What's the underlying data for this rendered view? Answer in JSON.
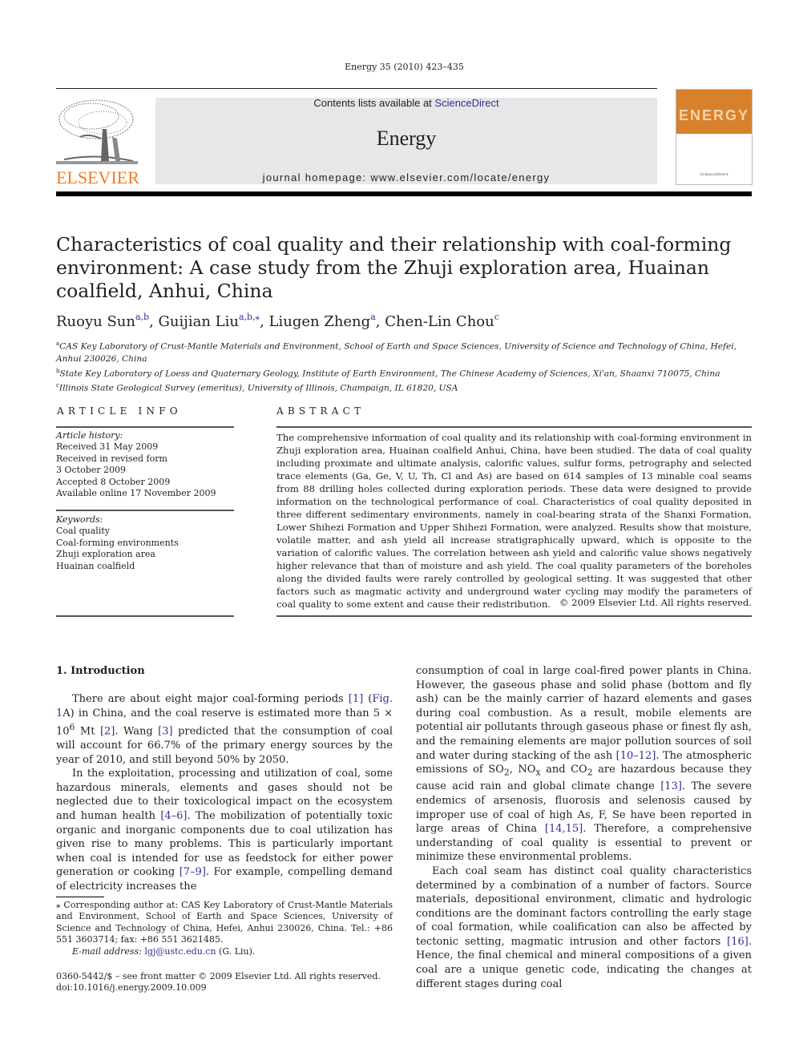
{
  "header": {
    "journal_ref": "Energy 35 (2010) 423–435",
    "contents_prefix": "Contents lists available at ",
    "contents_link": "ScienceDirect",
    "journal_name": "Energy",
    "homepage": "journal homepage: www.elsevier.com/locate/energy",
    "publisher_logo_text": "ELSEVIER",
    "cover_title": "ENERGY",
    "cover_footer": "ScienceDirect"
  },
  "colors": {
    "link": "#2e3192",
    "elsevier_orange": "#f27b21",
    "banner_gray": "#e6e7e8",
    "cover_orange": "#d8812d"
  },
  "article": {
    "title": "Characteristics of coal quality and their relationship with coal-forming environment: A case study from the Zhuji exploration area, Huainan coalfield, Anhui, China",
    "authors": [
      {
        "name": "Ruoyu Sun",
        "aff": "a,b"
      },
      {
        "name": "Guijian Liu",
        "aff": "a,b,⁎"
      },
      {
        "name": "Liugen Zheng",
        "aff": "a"
      },
      {
        "name": "Chen-Lin Chou",
        "aff": "c"
      }
    ],
    "affiliations": [
      {
        "mark": "a",
        "text": "CAS Key Laboratory of Crust-Mantle Materials and Environment, School of Earth and Space Sciences, University of Science and Technology of China, Hefei, Anhui 230026, China"
      },
      {
        "mark": "b",
        "text": "State Key Laboratory of Loess and Quaternary Geology, Institute of Earth Environment, The Chinese Academy of Sciences, Xi'an, Shaanxi 710075, China"
      },
      {
        "mark": "c",
        "text": "Illinois State Geological Survey (emeritus), University of Illinois, Champaign, IL 61820, USA"
      }
    ]
  },
  "article_info": {
    "heading": "ARTICLE INFO",
    "history_label": "Article history:",
    "history": [
      "Received 31 May 2009",
      "Received in revised form",
      "3 October 2009",
      "Accepted 8 October 2009",
      "Available online 17 November 2009"
    ],
    "keywords_label": "Keywords:",
    "keywords": [
      "Coal quality",
      "Coal-forming environments",
      "Zhuji exploration area",
      "Huainan coalfield"
    ]
  },
  "abstract": {
    "heading": "ABSTRACT",
    "text": "The comprehensive information of coal quality and its relationship with coal-forming environment in Zhuji exploration area, Huainan coalfield Anhui, China, have been studied. The data of coal quality including proximate and ultimate analysis, calorific values, sulfur forms, petrography and selected trace elements (Ga, Ge, V, U, Th, Cl and As) are based on 614 samples of 13 minable coal seams from 88 drilling holes collected during exploration periods. These data were designed to provide information on the technological performance of coal. Characteristics of coal quality deposited in three different sedimentary environments, namely in coal-bearing strata of the Shanxi Formation, Lower Shihezi Formation and Upper Shihezi Formation, were analyzed. Results show that moisture, volatile matter, and ash yield all increase stratigraphically upward, which is opposite to the variation of calorific values. The correlation between ash yield and calorific value shows negatively higher relevance that than of moisture and ash yield. The coal quality parameters of the boreholes along the divided faults were rarely controlled by geological setting. It was suggested that other factors such as magmatic activity and underground water cycling may modify the parameters of coal quality to some extent and cause their redistribution.",
    "copyright": "© 2009 Elsevier Ltd. All rights reserved."
  },
  "body": {
    "section_heading": "1.  Introduction",
    "col1": {
      "p1": [
        "There are about eight major coal-forming periods ",
        "[1]",
        " (",
        "Fig. 1",
        "A) in China, and the coal reserve is estimated more than 5 × 10",
        "6",
        " Mt ",
        "[2]",
        ". Wang ",
        "[3]",
        " predicted that the consumption of coal will account for 66.7% of the primary energy sources by the year of 2010, and still beyond 50% by 2050."
      ],
      "p2": [
        "In the exploitation, processing and utilization of coal, some hazardous minerals, elements and gases should not be neglected due to their toxicological impact on the ecosystem and human health ",
        "[4–6]",
        ". The mobilization of potentially toxic organic and inorganic components due to coal utilization has given rise to many problems. This is particularly important when coal is intended for use as feedstock for either power generation or cooking ",
        "[7–9]",
        ". For example, compelling demand of electricity increases the"
      ]
    },
    "col2": {
      "p1": [
        "consumption of coal in large coal-fired power plants in China. However, the gaseous phase and solid phase (bottom and fly ash) can be the mainly carrier of hazard elements and gases during coal combustion. As a result, mobile elements are potential air pollutants through gaseous phase or finest fly ash, and the remaining elements are major pollution sources of soil and water during stacking of the ash ",
        "[10–12]",
        ". The atmospheric emissions of SO",
        "2",
        ", NO",
        "x",
        " and CO",
        "2",
        " are hazardous because they cause acid rain and global climate change ",
        "[13]",
        ". The severe endemics of arsenosis, fluorosis and selenosis caused by improper use of coal of high As, F, Se have been reported in large areas of China ",
        "[14,15]",
        ". Therefore, a comprehensive understanding of coal quality is essential to prevent or minimize these environmental problems."
      ],
      "p2": [
        "Each coal seam has distinct coal quality characteristics determined by a combination of a number of factors. Source materials, depositional environment, climatic and hydrologic conditions are the dominant factors controlling the early stage of coal formation, while coalification can also be affected by tectonic setting, magmatic intrusion and other factors ",
        "[16]",
        ". Hence, the final chemical and mineral compositions of a given coal are a unique genetic code, indicating the changes at different stages during coal"
      ]
    }
  },
  "footnote": {
    "corresponding": "⁎  Corresponding author at: CAS Key Laboratory of Crust-Mantle Materials and Environment, School of Earth and Space Sciences, University of Science and Technology of China, Hefei, Anhui 230026, China. Tel.: +86 551 3603714; fax: +86 551 3621485.",
    "email_label": "E-mail address:",
    "email": "lgj@ustc.edu.cn",
    "email_suffix": " (G. Liu).",
    "issn": "0360-5442/$ – see front matter © 2009 Elsevier Ltd. All rights reserved.",
    "doi": "doi:10.1016/j.energy.2009.10.009"
  }
}
